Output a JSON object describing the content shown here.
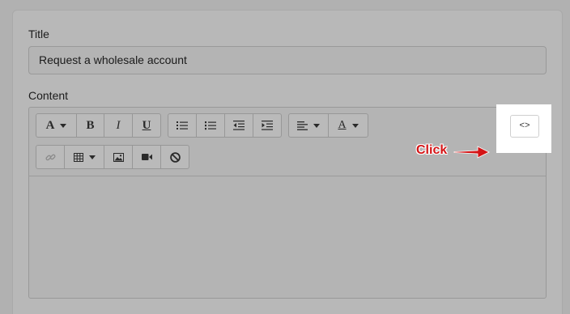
{
  "form": {
    "title_label": "Title",
    "title_value": "Request a wholesale account",
    "content_label": "Content"
  },
  "toolbar": {
    "row1": {
      "font_group": [
        {
          "name": "font-style-icon",
          "glyph": "A"
        },
        {
          "name": "bold-icon",
          "glyph": "B"
        },
        {
          "name": "italic-icon",
          "glyph": "I"
        },
        {
          "name": "underline-icon",
          "glyph": "U"
        }
      ],
      "list_group": [
        "unordered-list-icon",
        "ordered-list-icon",
        "outdent-icon",
        "indent-icon"
      ],
      "align_group": [
        "align-left-icon",
        "text-color-icon"
      ],
      "text_color_glyph": "A"
    },
    "row2": [
      "link-icon",
      "table-icon",
      "image-icon",
      "video-icon",
      "clear-format-icon"
    ],
    "code_button": "<>"
  },
  "annotation": {
    "text": "Click",
    "color": "#d41416"
  },
  "colors": {
    "highlight": "#ffffff",
    "overlay": "#b1b1b1"
  }
}
